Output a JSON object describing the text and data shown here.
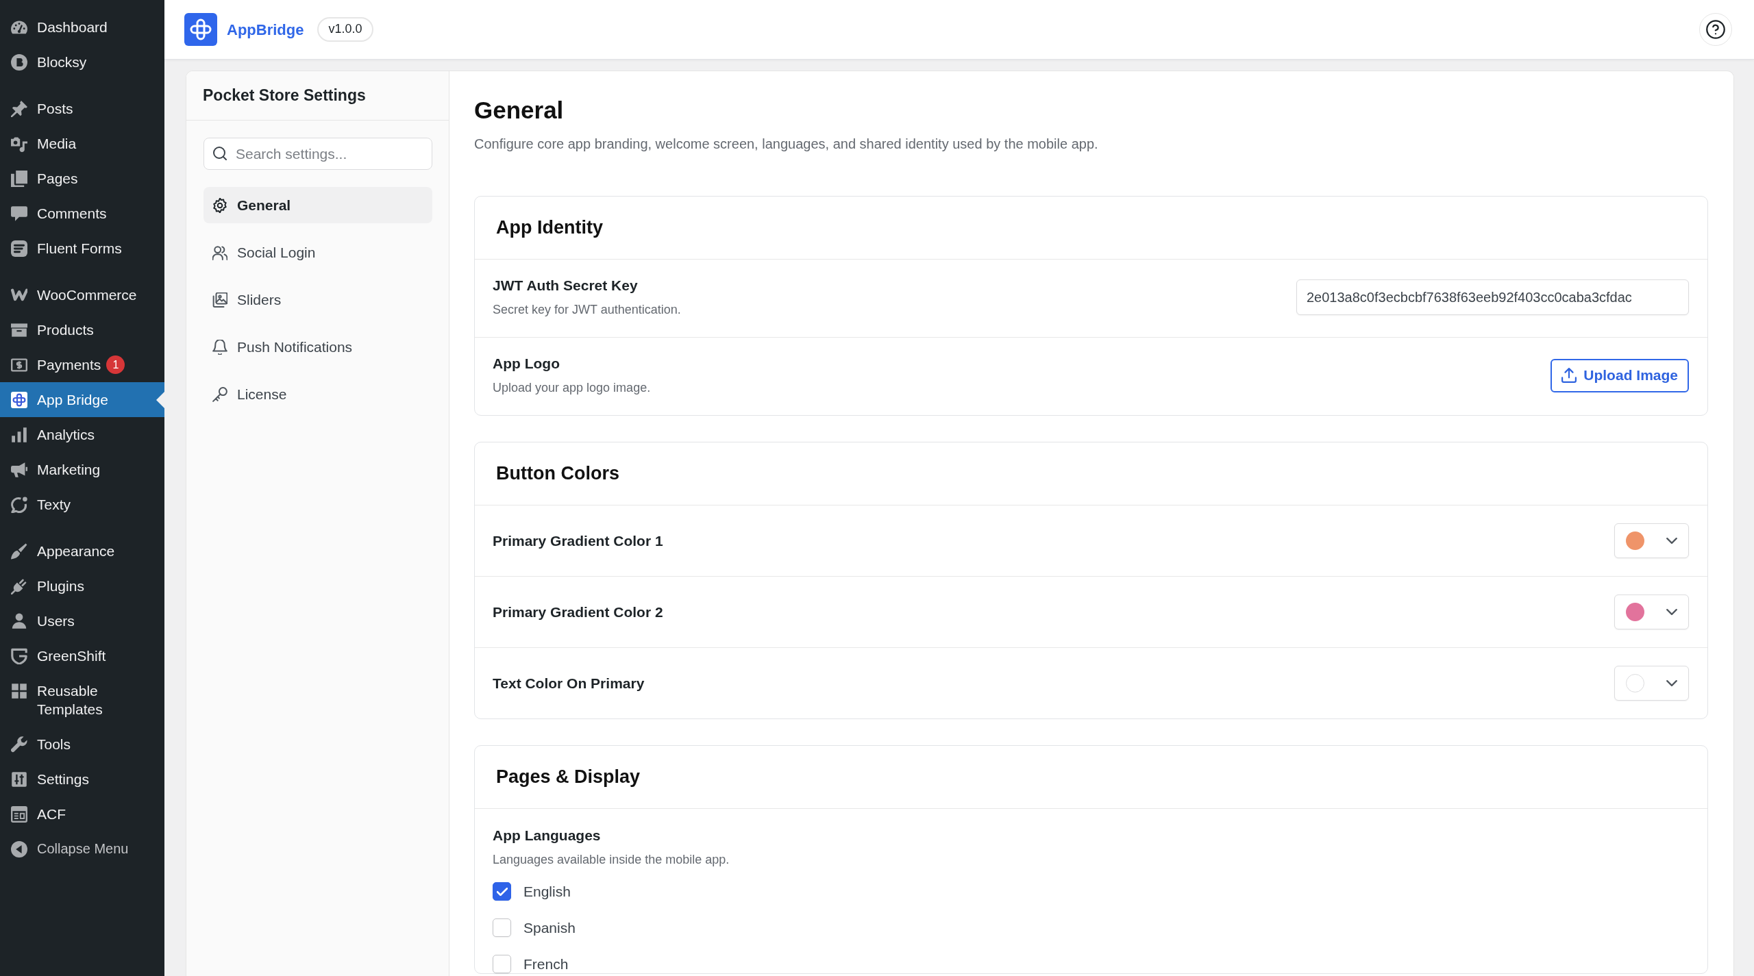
{
  "wp_sidebar": {
    "groups": [
      {
        "items": [
          {
            "label": "Dashboard",
            "selected": false
          },
          {
            "label": "Blocksy",
            "selected": false
          }
        ]
      },
      {
        "items": [
          {
            "label": "Posts",
            "selected": false
          },
          {
            "label": "Media",
            "selected": false
          },
          {
            "label": "Pages",
            "selected": false
          },
          {
            "label": "Comments",
            "selected": false
          },
          {
            "label": "Fluent Forms",
            "selected": false
          }
        ]
      },
      {
        "items": [
          {
            "label": "WooCommerce",
            "selected": false
          },
          {
            "label": "Products",
            "selected": false
          },
          {
            "label": "Payments",
            "selected": false,
            "badge": "1"
          },
          {
            "label": "App Bridge",
            "selected": true
          },
          {
            "label": "Analytics",
            "selected": false
          },
          {
            "label": "Marketing",
            "selected": false
          },
          {
            "label": "Texty",
            "selected": false
          }
        ]
      },
      {
        "items": [
          {
            "label": "Appearance",
            "selected": false
          },
          {
            "label": "Plugins",
            "selected": false
          },
          {
            "label": "Users",
            "selected": false
          },
          {
            "label": "GreenShift",
            "selected": false
          },
          {
            "label": "Reusable Templates",
            "selected": false
          },
          {
            "label": "Tools",
            "selected": false
          },
          {
            "label": "Settings",
            "selected": false
          },
          {
            "label": "ACF",
            "selected": false
          }
        ]
      }
    ],
    "collapse_label": "Collapse Menu"
  },
  "header": {
    "app_name": "AppBridge",
    "version": "v1.0.0"
  },
  "settings_nav": {
    "title": "Pocket Store Settings",
    "search": {
      "placeholder": "Search settings..."
    },
    "items": [
      {
        "label": "General",
        "selected": true
      },
      {
        "label": "Social Login",
        "selected": false
      },
      {
        "label": "Sliders",
        "selected": false
      },
      {
        "label": "Push Notifications",
        "selected": false
      },
      {
        "label": "License",
        "selected": false
      }
    ]
  },
  "content": {
    "title": "General",
    "description": "Configure core app branding, welcome screen, languages, and shared identity used by the mobile app.",
    "sections": [
      {
        "title": "App Identity",
        "rows": [
          {
            "kind": "text",
            "label": "JWT Auth Secret Key",
            "description": "Secret key for JWT authentication.",
            "value": "2e013a8c0f3ecbcbf7638f63eeb92f403cc0caba3cfdac"
          },
          {
            "kind": "upload",
            "label": "App Logo",
            "description": "Upload your app logo image.",
            "button": "Upload Image"
          }
        ]
      },
      {
        "title": "Button Colors",
        "rows": [
          {
            "kind": "color",
            "label": "Primary Gradient Color 1",
            "color": "#ef9469"
          },
          {
            "kind": "color",
            "label": "Primary Gradient Color 2",
            "color": "#e2739c"
          },
          {
            "kind": "color",
            "label": "Text Color On Primary",
            "color": "#ffffff"
          }
        ]
      },
      {
        "title": "Pages & Display",
        "rows": [
          {
            "kind": "checklist",
            "label": "App Languages",
            "description": "Languages available inside the mobile app.",
            "options": [
              {
                "label": "English",
                "checked": true
              },
              {
                "label": "Spanish",
                "checked": false
              },
              {
                "label": "French",
                "checked": false
              }
            ]
          }
        ]
      }
    ]
  }
}
